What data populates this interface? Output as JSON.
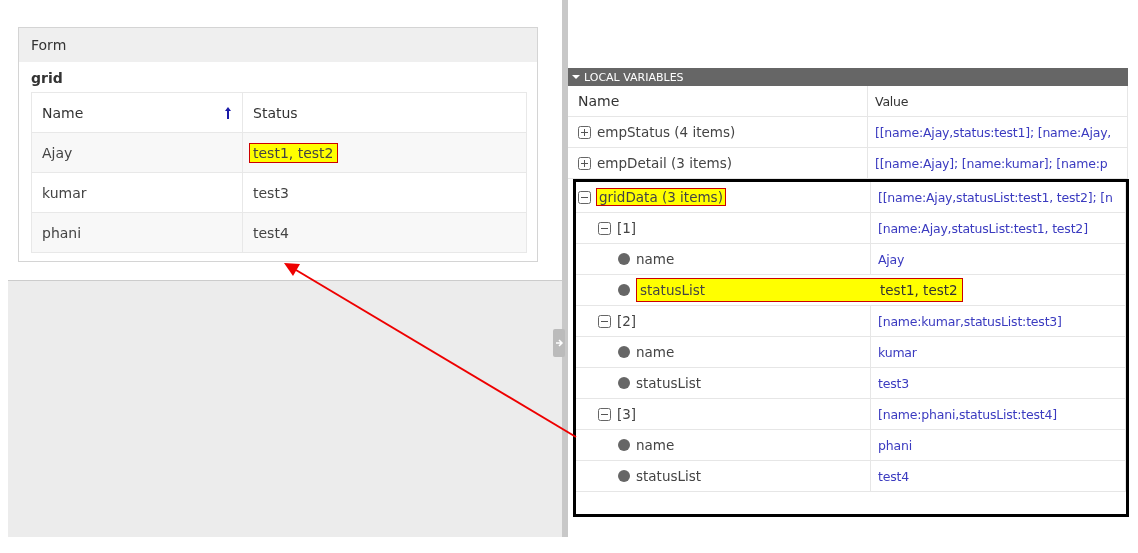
{
  "form": {
    "title": "Form",
    "grid": {
      "title": "grid",
      "columns": [
        {
          "label": "Name",
          "sorted": true
        },
        {
          "label": "Status",
          "sorted": false
        }
      ],
      "rows": [
        {
          "name": "Ajay",
          "status": "test1, test2",
          "highlighted": true
        },
        {
          "name": "kumar",
          "status": "test3",
          "highlighted": false
        },
        {
          "name": "phani",
          "status": "test4",
          "highlighted": false
        }
      ]
    }
  },
  "local_variables": {
    "title": "LOCAL VARIABLES",
    "expanded": true,
    "columns": [
      "Name",
      "Value"
    ],
    "items": [
      {
        "kind": "group",
        "name": "empStatus (4 items)",
        "value": "[[name:Ajay,status:test1]; [name:Ajay,",
        "expanded": false,
        "highlighted": false
      },
      {
        "kind": "group",
        "name": "empDetail (3 items)",
        "value": "[[name:Ajay]; [name:kumar]; [name:p",
        "expanded": false,
        "highlighted": false
      },
      {
        "kind": "group",
        "name": "gridData (3 items)",
        "value": "[[name:Ajay,statusList:test1, test2]; [n",
        "expanded": true,
        "highlighted": true,
        "framed": true,
        "children": [
          {
            "kind": "group",
            "name": "[1]",
            "value": "[name:Ajay,statusList:test1, test2]",
            "expanded": true,
            "highlighted": false,
            "children": [
              {
                "kind": "leaf",
                "name": "name",
                "value": "Ajay",
                "highlighted": false
              },
              {
                "kind": "leaf",
                "name": "statusList",
                "value": "test1, test2",
                "highlighted": true
              }
            ]
          },
          {
            "kind": "group",
            "name": "[2]",
            "value": "[name:kumar,statusList:test3]",
            "expanded": true,
            "highlighted": false,
            "children": [
              {
                "kind": "leaf",
                "name": "name",
                "value": "kumar",
                "highlighted": false
              },
              {
                "kind": "leaf",
                "name": "statusList",
                "value": "test3",
                "highlighted": false
              }
            ]
          },
          {
            "kind": "group",
            "name": "[3]",
            "value": "[name:phani,statusList:test4]",
            "expanded": true,
            "highlighted": false,
            "children": [
              {
                "kind": "leaf",
                "name": "name",
                "value": "phani",
                "highlighted": false
              },
              {
                "kind": "leaf",
                "name": "statusList",
                "value": "test4",
                "highlighted": false
              }
            ]
          }
        ]
      }
    ]
  },
  "annotation_arrow": true
}
